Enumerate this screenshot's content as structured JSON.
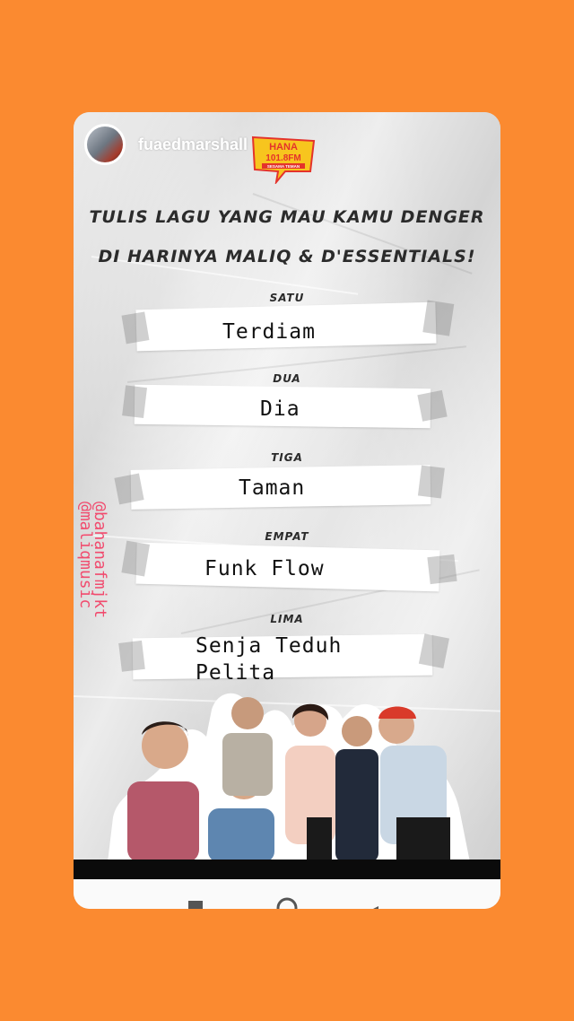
{
  "story": {
    "username": "fuaedmarshall",
    "logo": {
      "top": "HANA",
      "freq": "101.8FM",
      "tagline": "SESAMA TEMAN"
    },
    "headline_line1": "TULIS LAGU YANG MAU KAMU DENGER",
    "headline_line2": "DI HARINYA MALIQ & D'ESSENTIALS!",
    "items": [
      {
        "number": "SATU",
        "answer": "Terdiam"
      },
      {
        "number": "DUA",
        "answer": "Dia"
      },
      {
        "number": "TIGA",
        "answer": "Taman"
      },
      {
        "number": "EMPAT",
        "answer": "Funk Flow"
      },
      {
        "number": "LIMA",
        "answer_line1": "Senja Teduh",
        "answer_line2": "Pelita"
      }
    ],
    "mention1": "@bahanafmjkt",
    "mention2": "@maliqmusic"
  },
  "colors": {
    "background": "#fb8a30",
    "mention": "#f14b6e",
    "logo_yellow": "#f7c51e",
    "logo_red": "#e4332b"
  }
}
